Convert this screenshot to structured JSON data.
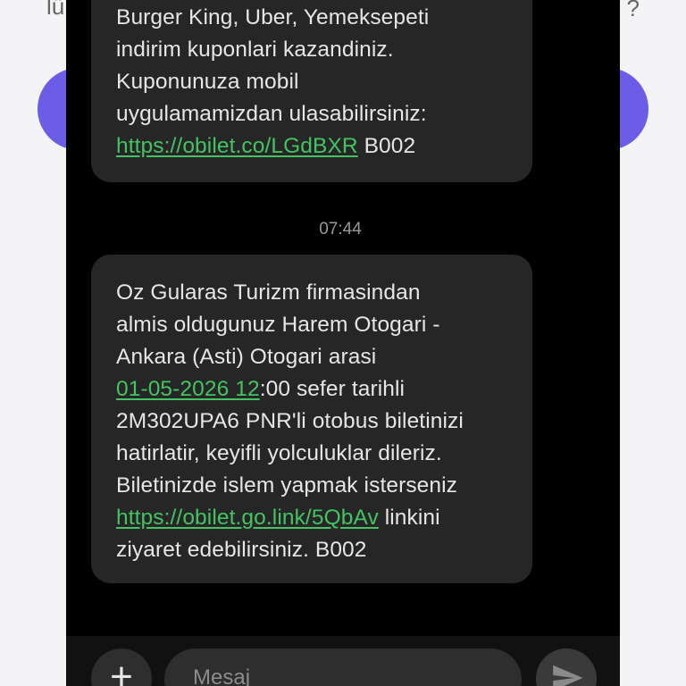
{
  "background": {
    "left_text": "lü",
    "right_text": "?"
  },
  "messages": [
    {
      "lines": [
        {
          "text": "Burger King, Uber, Yemeksepeti"
        },
        {
          "text": "indirim kuponlari kazandiniz."
        },
        {
          "text": "Kuponunuza mobil"
        },
        {
          "text": "uygulamamizdan ulasabilirsiniz:"
        },
        {
          "link": "https://obilet.co/LGdBXR",
          "text": " B002"
        }
      ]
    },
    {
      "timestamp": "07:44",
      "lines": [
        {
          "text": "Oz Gularas Turizm firmasindan"
        },
        {
          "text": "almis oldugunuz Harem Otogari -"
        },
        {
          "text": "Ankara (Asti) Otogari arasi"
        },
        {
          "link": "01-05-2026 12",
          "text": ":00 sefer tarihli"
        },
        {
          "text": "2M302UPA6 PNR'li otobus biletinizi"
        },
        {
          "text": "hatirlatir, keyifli yolculuklar dileriz."
        },
        {
          "text": "Biletinizde islem yapmak isterseniz"
        },
        {
          "link": "https://obilet.go.link/5QbAv",
          "text": " linkini"
        },
        {
          "text": "ziyaret edebilirsiniz. B002"
        }
      ]
    }
  ],
  "composer": {
    "plus_label": "+",
    "placeholder": "Mesaj",
    "send_icon": "send-icon"
  },
  "colors": {
    "link": "#43c463",
    "bubble": "#262626",
    "accent_background": "#6c5ce7"
  }
}
